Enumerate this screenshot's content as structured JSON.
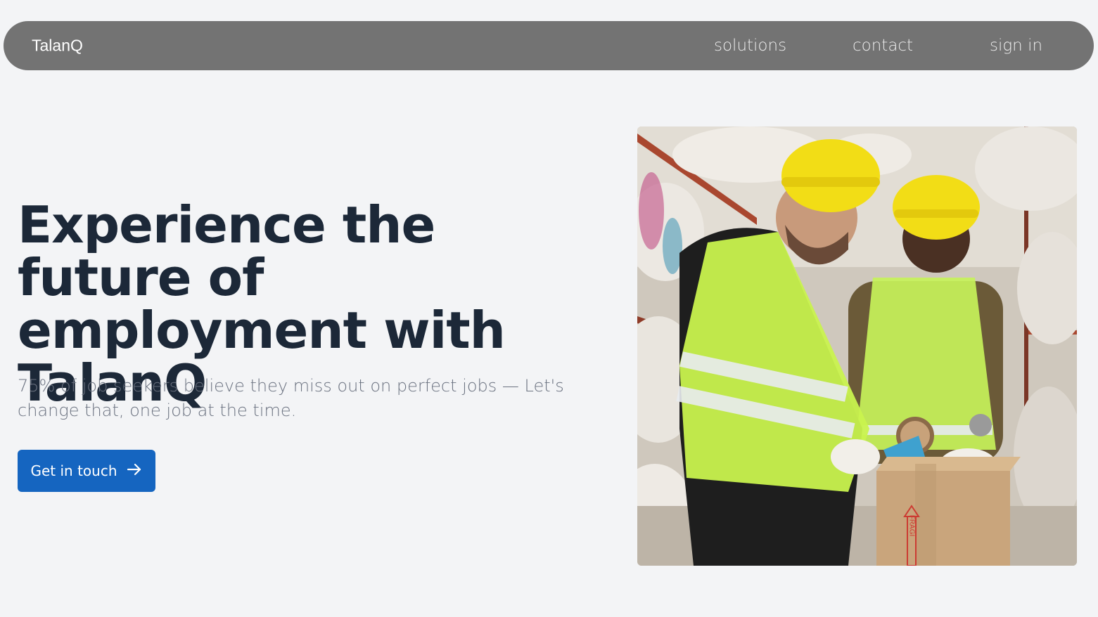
{
  "nav": {
    "brand": "TalanQ",
    "links": [
      "solutions",
      "contact",
      "sign in"
    ]
  },
  "hero": {
    "title": "Experience the future of employment with TalanQ",
    "subtitle": "75% of job seekers believe they miss out on perfect jobs — Let's change that, one job at the time.",
    "cta_label": "Get in touch",
    "cta_icon": "arrow-right-icon",
    "image_box_text": "FRAGI"
  },
  "colors": {
    "navbar": "#737373",
    "background": "#f3f4f6",
    "title": "#1c2838",
    "subtitle": "#6b7280",
    "cta": "#1565c0"
  }
}
